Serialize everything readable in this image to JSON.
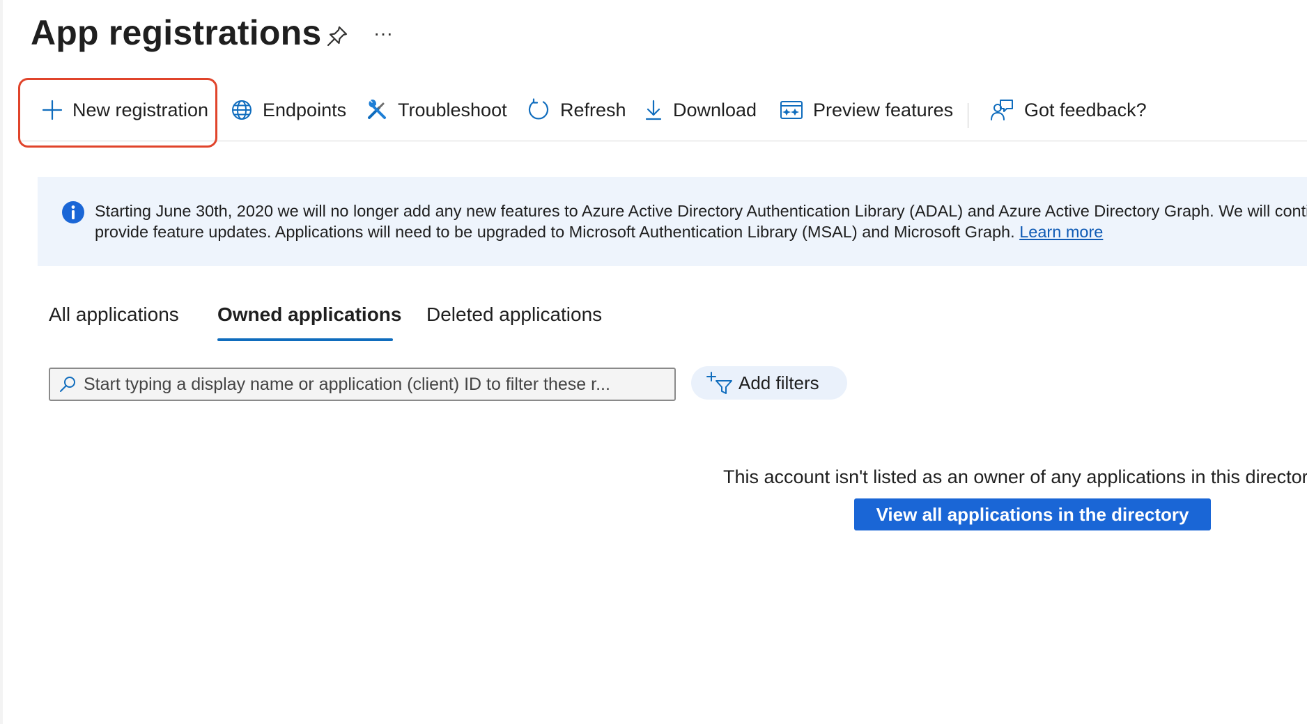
{
  "header": {
    "title": "App registrations",
    "more_label": "···"
  },
  "toolbar": {
    "items": [
      {
        "label": "New registration",
        "icon": "plus-icon"
      },
      {
        "label": "Endpoints",
        "icon": "globe-icon"
      },
      {
        "label": "Troubleshoot",
        "icon": "wrench-screwdriver-icon"
      },
      {
        "label": "Refresh",
        "icon": "refresh-icon"
      },
      {
        "label": "Download",
        "icon": "download-icon"
      },
      {
        "label": "Preview features",
        "icon": "preview-features-icon"
      },
      {
        "label": "Got feedback?",
        "icon": "feedback-icon"
      }
    ]
  },
  "banner": {
    "line1": "Starting June 30th, 2020 we will no longer add any new features to Azure Active Directory Authentication Library (ADAL) and Azure Active Directory Graph. We will continue to provide technical support and security updates but we will no longer",
    "line2": "provide feature updates. Applications will need to be upgraded to Microsoft Authentication Library (MSAL) and Microsoft Graph. ",
    "link": "Learn more",
    "icon": "info-icon"
  },
  "tabs": [
    {
      "label": "All applications",
      "selected": false
    },
    {
      "label": "Owned applications",
      "selected": true
    },
    {
      "label": "Deleted applications",
      "selected": false
    }
  ],
  "search": {
    "placeholder": "Start typing a display name or application (client) ID to filter these r...",
    "value": ""
  },
  "filters": {
    "add_label": "Add filters"
  },
  "empty_state": {
    "message": "This account isn't listed as an owner of any applications in this directory.",
    "button_label": "View all applications in the directory"
  },
  "colors": {
    "accent": "#0f6cbd",
    "primary_button": "#1a66d6",
    "highlight": "#e0442b",
    "banner_bg": "#eef4fc",
    "info_icon": "#1a66d6"
  }
}
